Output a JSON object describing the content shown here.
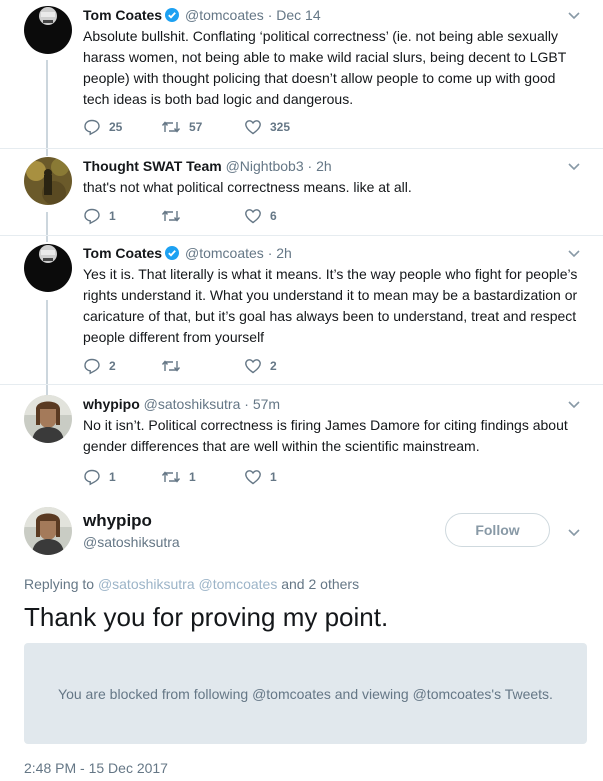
{
  "tweets": [
    {
      "name": "Tom Coates",
      "verified": true,
      "handle": "@tomcoates",
      "dot": "·",
      "time": "Dec 14",
      "text": "Absolute bullshit. Conflating ‘political correctness’ (ie. not being able sexually harass women, not being able to make wild racial slurs, being decent to LGBT people) with thought policing that doesn’t allow people to come up with good tech ideas is both bad logic and dangerous.",
      "replies": "25",
      "retweets": "57",
      "likes": "325"
    },
    {
      "name": "Thought SWAT Team",
      "verified": false,
      "handle": "@Nightbob3",
      "dot": "·",
      "time": "2h",
      "text": "that's not what political correctness means. like at all.",
      "replies": "1",
      "retweets": "",
      "likes": "6"
    },
    {
      "name": "Tom Coates",
      "verified": true,
      "handle": "@tomcoates",
      "dot": "·",
      "time": "2h",
      "text": "Yes it is. That literally is what it means. It’s the way people who fight for people’s rights understand it. What you understand it to mean may be a bastardization or caricature of that, but it’s goal has always been to understand, treat and respect people different from yourself",
      "replies": "2",
      "retweets": "",
      "likes": "2"
    },
    {
      "name": "whypipo",
      "verified": false,
      "handle": "@satoshiksutra",
      "dot": "·",
      "time": "57m",
      "text": "No it isn’t. Political correctness is firing James Damore for citing findings about gender differences that are well within the scientific mainstream.",
      "replies": "1",
      "retweets": "1",
      "likes": "1"
    }
  ],
  "main_tweet": {
    "name": "whypipo",
    "handle": "@satoshiksutra",
    "follow_label": "Follow",
    "replying_prefix": "Replying to",
    "replying_user1": "@satoshiksutra",
    "replying_user2": "@tomcoates",
    "replying_suffix": "and 2 others",
    "text": "Thank you for proving my point.",
    "blocked_notice": "You are blocked from following @tomcoates and viewing @tomcoates's Tweets.",
    "timestamp": "2:48 PM - 15 Dec 2017"
  },
  "colors": {
    "verified_blue": "#1da1f2",
    "muted_text": "#657786",
    "link_faded": "#9cb4c8",
    "blocked_bg": "#e1e8ed"
  },
  "icons": {
    "reply": "reply-icon",
    "retweet": "retweet-icon",
    "like": "heart-icon",
    "caret": "chevron-down-icon",
    "verified": "verified-badge-icon"
  }
}
